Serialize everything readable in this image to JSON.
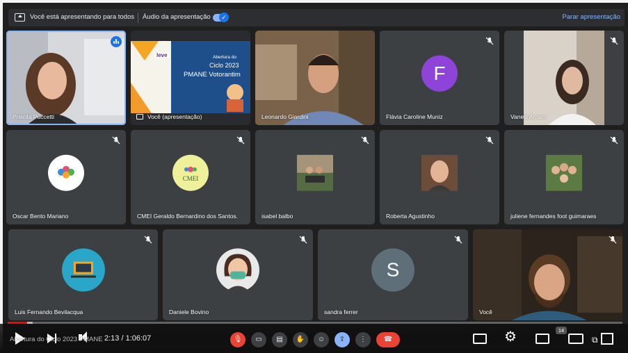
{
  "banner": {
    "presenting_text": "Você está apresentando para todos",
    "audio_label": "Áudio da apresentação",
    "stop_label": "Parar apresentação"
  },
  "presentation_slide": {
    "badge": "leve",
    "title_lines": [
      "Abertura do",
      "Ciclo 2023"
    ],
    "subtitle": "PMANE Votorantim"
  },
  "participants": [
    {
      "name": "Priscila Puccetti",
      "kind": "video"
    },
    {
      "name": "Você (apresentação)",
      "kind": "presentation"
    },
    {
      "name": "Leonardo Giardini",
      "kind": "video"
    },
    {
      "name": "Flávia Caroline Muniz",
      "kind": "letter",
      "letter": "F",
      "color": "#8e44d9"
    },
    {
      "name": "Vanelli Amaro",
      "kind": "video"
    },
    {
      "name": "Oscar Bento Mariano",
      "kind": "photo"
    },
    {
      "name": "CMEI Geraldo Bernardino dos Santos.",
      "kind": "photo",
      "text": "CMEI"
    },
    {
      "name": "isabel balbo",
      "kind": "photo"
    },
    {
      "name": "Roberta Agustinho",
      "kind": "photo"
    },
    {
      "name": "juliene fernandes foot guimaraes",
      "kind": "photo"
    },
    {
      "name": "Luis Fernando Bevilacqua",
      "kind": "photo"
    },
    {
      "name": "Daniele Bovino",
      "kind": "photo"
    },
    {
      "name": "sandra ferrer",
      "kind": "letter",
      "letter": "S",
      "color": "#5f6f79"
    },
    {
      "name": "Você",
      "kind": "video"
    }
  ],
  "player": {
    "video_title": "Abertura do Ciclo 2023 PMANE Votorantim",
    "time": "2:13 / 1:06:07",
    "played_fraction": 0.032,
    "loaded_fraction": 0.041,
    "playlist_count": "14"
  },
  "colors": {
    "accent": "#8ab4f8",
    "end_call": "#ea4335",
    "progress": "#ff0000"
  }
}
